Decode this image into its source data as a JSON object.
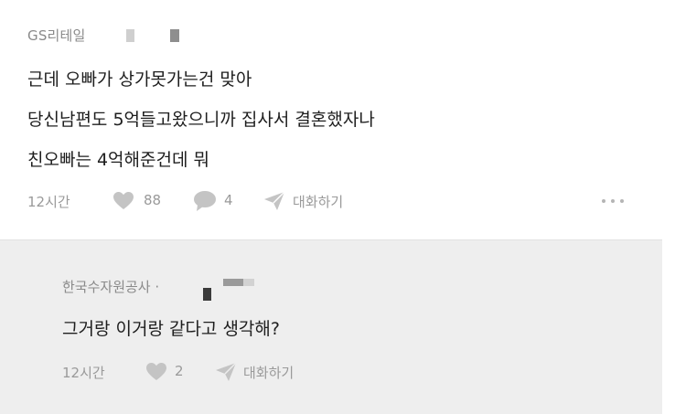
{
  "comment": {
    "company": "GS리테일",
    "lines": [
      "근데 오빠가 상가못가는건 맞아",
      "당신남편도 5억들고왔으니까 집사서 결혼했자나",
      "친오빠는 4억해준건데 뭐"
    ],
    "time": "12시간",
    "likes": "88",
    "comments": "4",
    "reply_label": "대화하기"
  },
  "reply": {
    "company": "한국수자원공사 ·",
    "text": "그거랑 이거랑 같다고 생각해?",
    "time": "12시간",
    "likes": "2",
    "reply_label": "대화하기"
  },
  "icons": {
    "like": "heart-icon",
    "comment": "speech-bubble-icon",
    "share": "paper-plane-icon",
    "more": "more-dots-icon"
  },
  "colors": {
    "meta_gray": "#9a9a9a",
    "reply_bg": "#eeeeee"
  }
}
